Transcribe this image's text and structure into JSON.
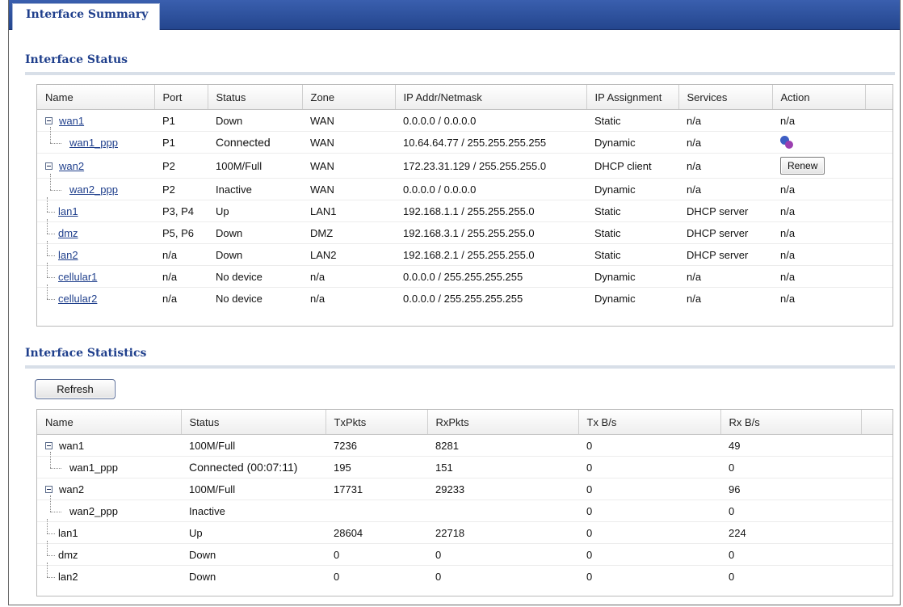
{
  "tabs": {
    "active": "Interface Summary"
  },
  "status_section": {
    "title": "Interface Status",
    "columns": [
      "Name",
      "Port",
      "Status",
      "Zone",
      "IP Addr/Netmask",
      "IP Assignment",
      "Services",
      "Action",
      ""
    ],
    "rows": [
      {
        "name": "wan1",
        "port": "P1",
        "status": "Down",
        "zone": "WAN",
        "ip": "0.0.0.0 / 0.0.0.0",
        "assign": "Static",
        "services": "n/a",
        "action": "n/a"
      },
      {
        "name": "wan1_ppp",
        "port": "P1",
        "status": "Connected",
        "zone": "WAN",
        "ip": "10.64.64.77 / 255.255.255.255",
        "assign": "Dynamic",
        "services": "n/a",
        "action_icon": "connect-icon"
      },
      {
        "name": "wan2",
        "port": "P2",
        "status": "100M/Full",
        "zone": "WAN",
        "ip": "172.23.31.129 / 255.255.255.0",
        "assign": "DHCP client",
        "services": "n/a",
        "action_button": "Renew"
      },
      {
        "name": "wan2_ppp",
        "port": "P2",
        "status": "Inactive",
        "zone": "WAN",
        "ip": "0.0.0.0 / 0.0.0.0",
        "assign": "Dynamic",
        "services": "n/a",
        "action": "n/a"
      },
      {
        "name": "lan1",
        "port": "P3, P4",
        "status": "Up",
        "zone": "LAN1",
        "ip": "192.168.1.1 / 255.255.255.0",
        "assign": "Static",
        "services": "DHCP server",
        "action": "n/a"
      },
      {
        "name": "dmz",
        "port": "P5, P6",
        "status": "Down",
        "zone": "DMZ",
        "ip": "192.168.3.1 / 255.255.255.0",
        "assign": "Static",
        "services": "DHCP server",
        "action": "n/a"
      },
      {
        "name": "lan2",
        "port": "n/a",
        "status": "Down",
        "zone": "LAN2",
        "ip": "192.168.2.1 / 255.255.255.0",
        "assign": "Static",
        "services": "DHCP server",
        "action": "n/a"
      },
      {
        "name": "cellular1",
        "port": "n/a",
        "status": "No device",
        "zone": "n/a",
        "ip": "0.0.0.0 / 255.255.255.255",
        "assign": "Dynamic",
        "services": "n/a",
        "action": "n/a"
      },
      {
        "name": "cellular2",
        "port": "n/a",
        "status": "No device",
        "zone": "n/a",
        "ip": "0.0.0.0 / 255.255.255.255",
        "assign": "Dynamic",
        "services": "n/a",
        "action": "n/a"
      }
    ]
  },
  "stats_section": {
    "title": "Interface Statistics",
    "refresh_label": "Refresh",
    "columns": [
      "Name",
      "Status",
      "TxPkts",
      "RxPkts",
      "Tx B/s",
      "Rx B/s",
      ""
    ],
    "rows": [
      {
        "name": "wan1",
        "status": "100M/Full",
        "tx": "7236",
        "rx": "8281",
        "txbs": "0",
        "rxbs": "49"
      },
      {
        "name": "wan1_ppp",
        "status": "Connected (00:07:11)",
        "tx": "195",
        "rx": "151",
        "txbs": "0",
        "rxbs": "0"
      },
      {
        "name": "wan2",
        "status": "100M/Full",
        "tx": "17731",
        "rx": "29233",
        "txbs": "0",
        "rxbs": "96"
      },
      {
        "name": "wan2_ppp",
        "status": "Inactive",
        "tx": "",
        "rx": "",
        "txbs": "0",
        "rxbs": "0"
      },
      {
        "name": "lan1",
        "status": "Up",
        "tx": "28604",
        "rx": "22718",
        "txbs": "0",
        "rxbs": "224"
      },
      {
        "name": "dmz",
        "status": "Down",
        "tx": "0",
        "rx": "0",
        "txbs": "0",
        "rxbs": "0"
      },
      {
        "name": "lan2",
        "status": "Down",
        "tx": "0",
        "rx": "0",
        "txbs": "0",
        "rxbs": "0"
      }
    ]
  },
  "colors": {
    "header_blue": "#2a4c96",
    "link": "#1f3f8c",
    "error": "#d80000"
  }
}
